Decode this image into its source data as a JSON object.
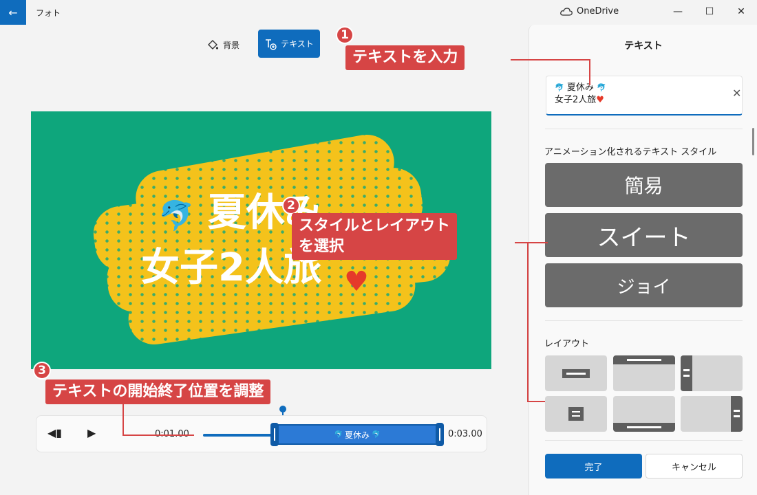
{
  "titlebar": {
    "app_title": "フォト",
    "back_glyph": "←",
    "onedrive_label": "OneDrive",
    "minimize": "—",
    "maximize": "☐",
    "close": "✕"
  },
  "toolbar": {
    "background_label": "背景",
    "text_label": "テキスト"
  },
  "preview": {
    "line1": "夏休み",
    "line2": "女子2人旅",
    "heart": "♥",
    "dolphin": "🐬"
  },
  "timeline": {
    "prev_glyph": "◀▮",
    "play_glyph": "▶",
    "current_time": "0:01.00",
    "end_time": "0:03.00",
    "clip_label": "夏休み"
  },
  "panel": {
    "title": "テキスト",
    "input_line1": "夏休み",
    "input_line2": "女子2人旅",
    "clear_glyph": "✕",
    "styles_label": "アニメーション化されるテキスト スタイル",
    "styles": [
      "簡易",
      "スイート",
      "ジョイ"
    ],
    "layout_label": "レイアウト",
    "done_label": "完了",
    "cancel_label": "キャンセル"
  },
  "annotations": {
    "step1_num": "1",
    "step1_text": "テキストを入力",
    "step2_num": "2",
    "step2_line1": "スタイルとレイアウト",
    "step2_line2": "を選択",
    "step3_num": "3",
    "step3_text": "テキストの開始終了位置を調整"
  },
  "colors": {
    "accent": "#0f6cbd",
    "callout": "#d64545",
    "preview_bg": "#0ea67c",
    "brush": "#f4c21b",
    "style_tile": "#6b6b6b"
  }
}
